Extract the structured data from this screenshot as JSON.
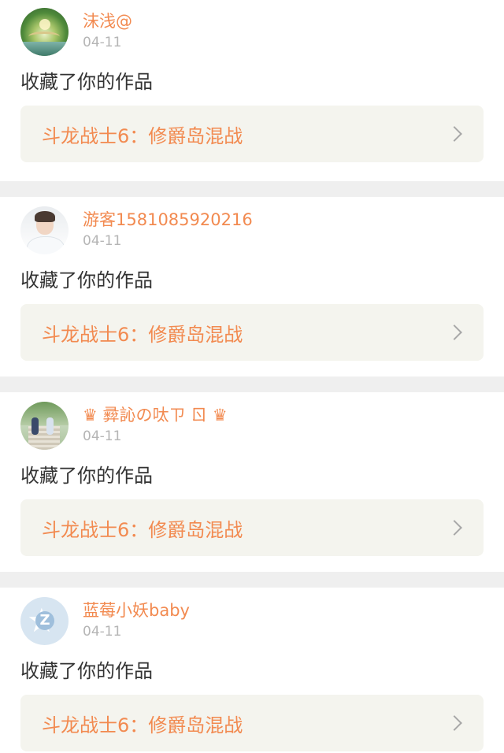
{
  "notifications": [
    {
      "avatar": "forest-bridge-avatar",
      "username": "沫浅@",
      "date": "04-11",
      "action": "收藏了你的作品",
      "work_title": "斗龙战士6：修爵岛混战"
    },
    {
      "avatar": "boy-photo-avatar",
      "username": "游客1581085920216",
      "date": "04-11",
      "action": "收藏了你的作品",
      "work_title": "斗龙战士6：修爵岛混战"
    },
    {
      "avatar": "couple-path-avatar",
      "username": "♛ 彛訫の呔ㄗ ㄖ ♛",
      "date": "04-11",
      "action": "收藏了你的作品",
      "work_title": "斗龙战士6：修爵岛混战"
    },
    {
      "avatar": "default-avatar",
      "username": "蓝莓小妖baby",
      "date": "04-11",
      "action": "收藏了你的作品",
      "work_title": "斗龙战士6：修爵岛混战"
    }
  ],
  "colors": {
    "accent": "#f28a50",
    "card_bg": "#ffffff",
    "page_bg": "#efefef",
    "link_bg": "#f4f4ee",
    "date": "#b5b5b5",
    "text": "#333333"
  },
  "icons": {
    "chevron": "chevron-right-icon"
  }
}
